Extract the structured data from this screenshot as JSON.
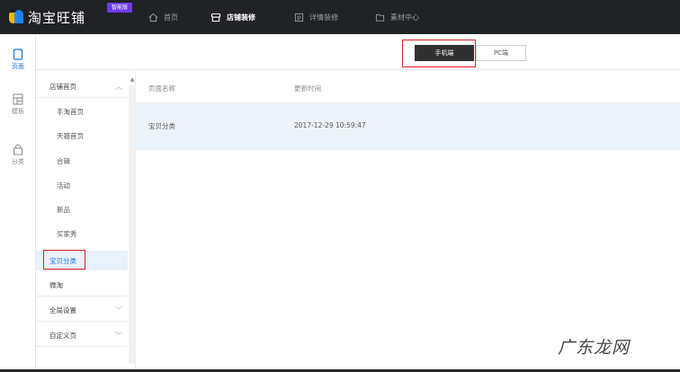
{
  "app": {
    "brand": "淘宝旺铺",
    "badge": "智能版"
  },
  "nav": [
    {
      "label": "首页",
      "icon": "home-icon"
    },
    {
      "label": "店铺装修",
      "icon": "store-icon",
      "active": true
    },
    {
      "label": "详情装修",
      "icon": "detail-icon"
    },
    {
      "label": "素材中心",
      "icon": "folder-icon"
    }
  ],
  "rail": [
    {
      "label": "页面",
      "icon": "page-icon",
      "active": true
    },
    {
      "label": "模板",
      "icon": "template-icon"
    },
    {
      "label": "分类",
      "icon": "bag-icon"
    }
  ],
  "toolbar": {
    "mobile_label": "手机端",
    "pc_label": "PC端"
  },
  "panel": {
    "groups": [
      {
        "label": "店铺首页",
        "chevron": "up"
      },
      {
        "label": "微淘"
      },
      {
        "label": "全局设置",
        "chevron": "down"
      },
      {
        "label": "自定义页",
        "chevron": "down"
      }
    ],
    "sub_items": [
      "手淘首页",
      "天猫首页",
      "合辑",
      "活动",
      "新品",
      "买家秀",
      "宝贝分类"
    ],
    "selected": "宝贝分类"
  },
  "table": {
    "headers": [
      "页面名称",
      "更新时间"
    ],
    "rows": [
      {
        "name": "宝贝分类",
        "time": "2017-12-29 10:59:47"
      }
    ]
  },
  "watermark": "广东龙网",
  "colors": {
    "topbar": "#202226",
    "accent": "#1a73e8",
    "highlight": "#e02020",
    "badge": "#6e3ce8"
  }
}
